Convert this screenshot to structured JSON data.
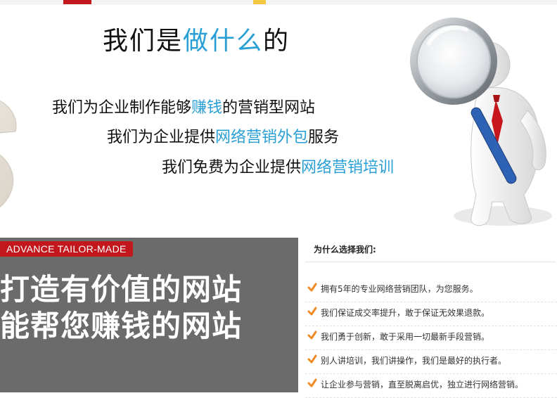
{
  "hero": {
    "title_pre": "我们是",
    "title_hl": "做什么",
    "title_post": "的",
    "lines": [
      {
        "pre": "我们为企业制作能够",
        "hl": "赚钱",
        "post": "的营销型网站"
      },
      {
        "pre": "我们为企业提供",
        "hl": "网络营销外包",
        "post": "服务"
      },
      {
        "pre": "我们免费为企业提供",
        "hl": "网络营销培训",
        "post": ""
      }
    ]
  },
  "banner": {
    "badge": "ADVANCE TAILOR-MADE",
    "line1": "打造有价值的网站",
    "line2": "能帮您赚钱的网站"
  },
  "why": {
    "title": "为什么选择我们:",
    "items": [
      "拥有5年的专业网络营销团队，为您服务。",
      "我们保证成交率提升，敢于保证无效果退款。",
      "我们勇于创新，敢于采用一切最新手段营销。",
      "别人讲培训，我们讲操作，我们是最好的执行者。",
      "让企业参与营销，直至脱离启优，独立进行网络营销。"
    ]
  },
  "colors": {
    "accent": "#2a9fd6",
    "badge": "#c2171c",
    "banner_bg": "#6b6b6b",
    "check": "#f08a24"
  },
  "icons": {
    "check": "check-icon",
    "magnifier": "magnifier-figure",
    "dollar": "dollar-graphic"
  }
}
